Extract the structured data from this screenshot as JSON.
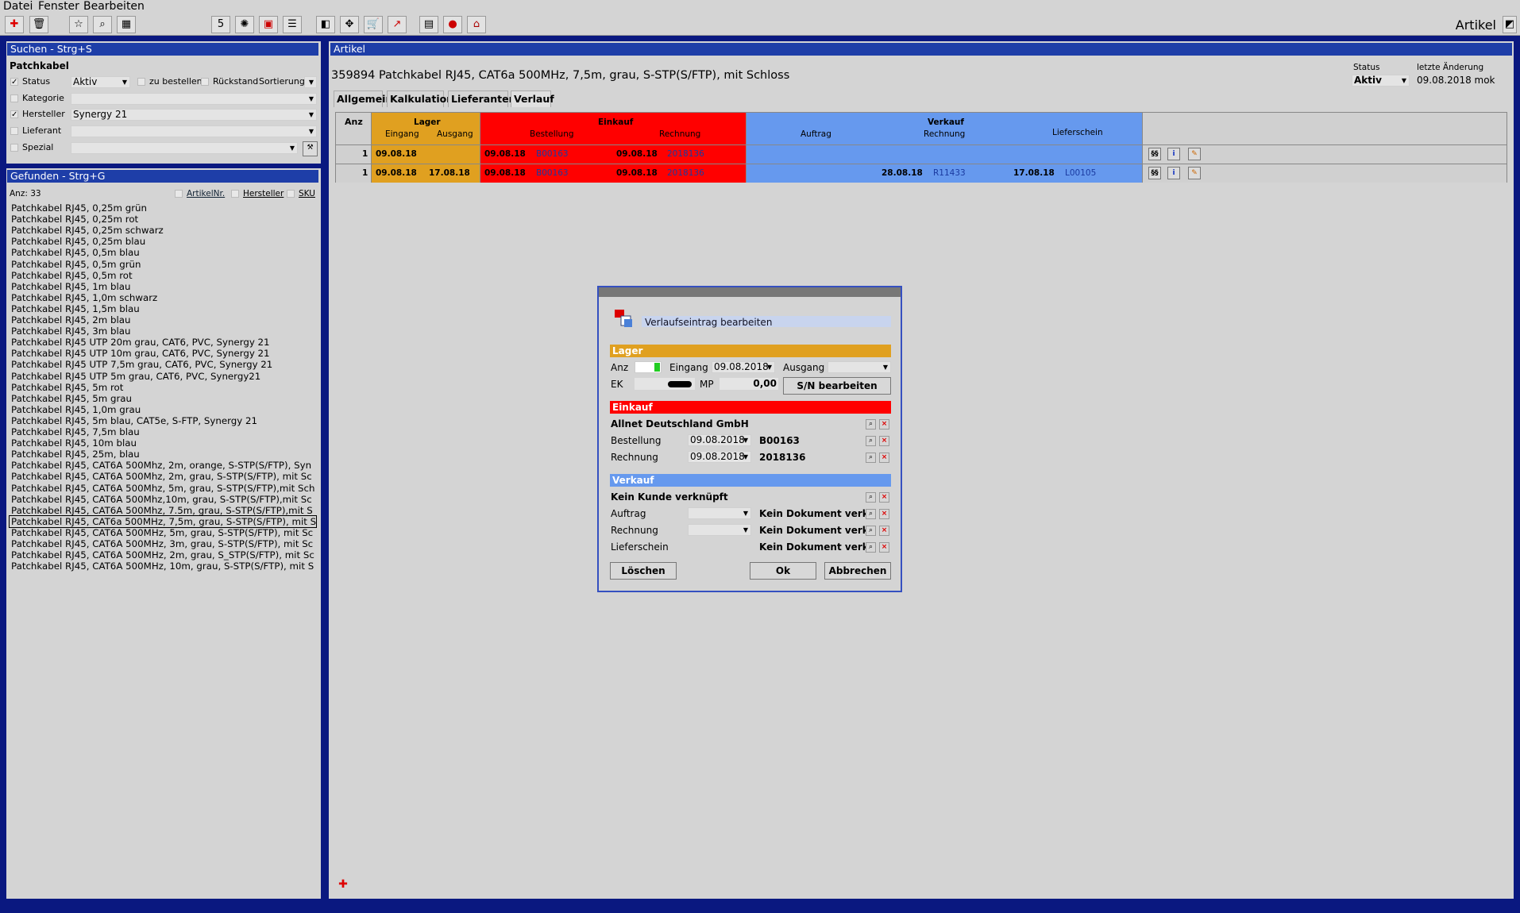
{
  "menu": {
    "datei": "Datei",
    "fenster": "Fenster",
    "bearbeiten": "Bearbeiten"
  },
  "toolbar": {
    "title": "Artikel"
  },
  "search": {
    "title": "Suchen - Strg+S",
    "query": "Patchkabel",
    "status_label": "Status",
    "status_value": "Aktiv",
    "zu_bestellen": "zu bestellen",
    "rueckstand": "Rückstand",
    "sortierung": "Sortierung",
    "kategorie": "Kategorie",
    "hersteller": "Hersteller",
    "hersteller_value": "Synergy 21",
    "lieferant": "Lieferant",
    "spezial": "Spezial"
  },
  "found": {
    "title": "Gefunden - Strg+G",
    "count": "Anz: 33",
    "col_artikelnr": "ArtikelNr.",
    "col_hersteller": "Hersteller",
    "col_sku": "SKU",
    "items": [
      "Patchkabel RJ45, 0,25m grün",
      "Patchkabel RJ45, 0,25m rot",
      "Patchkabel RJ45, 0,25m schwarz",
      "Patchkabel RJ45, 0,25m blau",
      "Patchkabel RJ45, 0,5m blau",
      "Patchkabel RJ45, 0,5m grün",
      "Patchkabel RJ45, 0,5m rot",
      "Patchkabel RJ45, 1m blau",
      "Patchkabel RJ45, 1,0m schwarz",
      "Patchkabel RJ45, 1,5m blau",
      "Patchkabel RJ45, 2m blau",
      "Patchkabel RJ45, 3m blau",
      "Patchkabel RJ45 UTP 20m grau, CAT6, PVC, Synergy 21",
      "Patchkabel RJ45 UTP 10m grau, CAT6, PVC, Synergy 21",
      "Patchkabel RJ45 UTP 7,5m grau, CAT6, PVC, Synergy 21",
      "Patchkabel RJ45 UTP 5m grau, CAT6, PVC, Synergy21",
      "Patchkabel RJ45, 5m rot",
      "Patchkabel RJ45, 5m grau",
      "Patchkabel RJ45, 1,0m grau",
      "Patchkabel RJ45, 5m blau, CAT5e, S-FTP, Synergy 21",
      "Patchkabel RJ45, 7,5m blau",
      "Patchkabel RJ45, 10m blau",
      "Patchkabel RJ45, 25m, blau",
      "Patchkabel RJ45, CAT6A 500Mhz, 2m, orange, S-STP(S/FTP), Syn",
      "Patchkabel RJ45, CAT6A 500Mhz, 2m, grau, S-STP(S/FTP), mit Sc",
      "Patchkabel RJ45, CAT6A 500Mhz, 5m, grau, S-STP(S/FTP),mit Sch",
      "Patchkabel RJ45, CAT6A 500Mhz,10m, grau, S-STP(S/FTP),mit Sc",
      "Patchkabel RJ45, CAT6A 500Mhz, 7.5m, grau, S-STP(S/FTP),mit S",
      "Patchkabel RJ45, CAT6a 500MHz, 7,5m, grau, S-STP(S/FTP), mit S",
      "Patchkabel RJ45, CAT6A 500MHz, 5m, grau, S-STP(S/FTP), mit Sc",
      "Patchkabel RJ45, CAT6A 500MHz, 3m, grau, S-STP(S/FTP), mit Sc",
      "Patchkabel RJ45, CAT6A 500MHz, 2m, grau, S_STP(S/FTP), mit Sc",
      "Patchkabel RJ45, CAT6A 500MHz, 10m, grau, S-STP(S/FTP), mit S"
    ],
    "selected_index": 28
  },
  "article": {
    "panel_title": "Artikel",
    "heading": "359894 Patchkabel RJ45, CAT6a 500MHz, 7,5m, grau, S-STP(S/FTP), mit Schloss",
    "status_label": "Status",
    "status_value": "Aktiv",
    "last_change_label": "letzte Änderung",
    "last_change_value": "09.08.2018 mok",
    "tabs": [
      "Allgemein",
      "Kalkulation",
      "Lieferanten",
      "Verlauf"
    ],
    "table": {
      "anz": "Anz",
      "lager": "Lager",
      "eingang": "Eingang",
      "ausgang": "Ausgang",
      "einkauf": "Einkauf",
      "bestellung": "Bestellung",
      "rechnung": "Rechnung",
      "verkauf": "Verkauf",
      "auftrag": "Auftrag",
      "v_rechnung": "Rechnung",
      "lieferschein": "Lieferschein",
      "rows": [
        {
          "anz": "1",
          "eingang": "09.08.18",
          "ausgang": "",
          "best_date": "09.08.18",
          "best_no": "B00163",
          "rech_date": "09.08.18",
          "rech_no": "2018136",
          "v_rech_date": "",
          "v_rech_no": "",
          "ls_date": "",
          "ls_no": ""
        },
        {
          "anz": "1",
          "eingang": "09.08.18",
          "ausgang": "17.08.18",
          "best_date": "09.08.18",
          "best_no": "B00163",
          "rech_date": "09.08.18",
          "rech_no": "2018136",
          "v_rech_date": "28.08.18",
          "v_rech_no": "R11433",
          "ls_date": "17.08.18",
          "ls_no": "L00105"
        }
      ]
    },
    "colors": {
      "lager": "#e0a020",
      "einkauf": "#ff0000",
      "verkauf": "#6699ee"
    }
  },
  "dialog": {
    "title": "Verlaufseintrag bearbeiten",
    "lager": "Lager",
    "anz": "Anz",
    "eingang": "Eingang",
    "eingang_value": "09.08.2018",
    "ausgang": "Ausgang",
    "ek": "EK",
    "mp": "MP",
    "mp_value": "0,00",
    "sn_button": "S/N bearbeiten",
    "einkauf": "Einkauf",
    "supplier": "Allnet Deutschland GmbH",
    "bestellung": "Bestellung",
    "bestellung_date": "09.08.2018",
    "bestellung_no": "B00163",
    "rechnung": "Rechnung",
    "rechnung_date": "09.08.2018",
    "rechnung_no": "2018136",
    "verkauf": "Verkauf",
    "kunde": "Kein Kunde verknüpft",
    "auftrag": "Auftrag",
    "auftrag_doc": "Kein Dokument verkn",
    "v_rechnung": "Rechnung",
    "v_rechnung_doc": "Kein Dokument verkn",
    "lieferschein": "Lieferschein",
    "lieferschein_doc": "Kein Dokument verkn",
    "loeschen": "Löschen",
    "ok": "Ok",
    "abbrechen": "Abbrechen"
  }
}
